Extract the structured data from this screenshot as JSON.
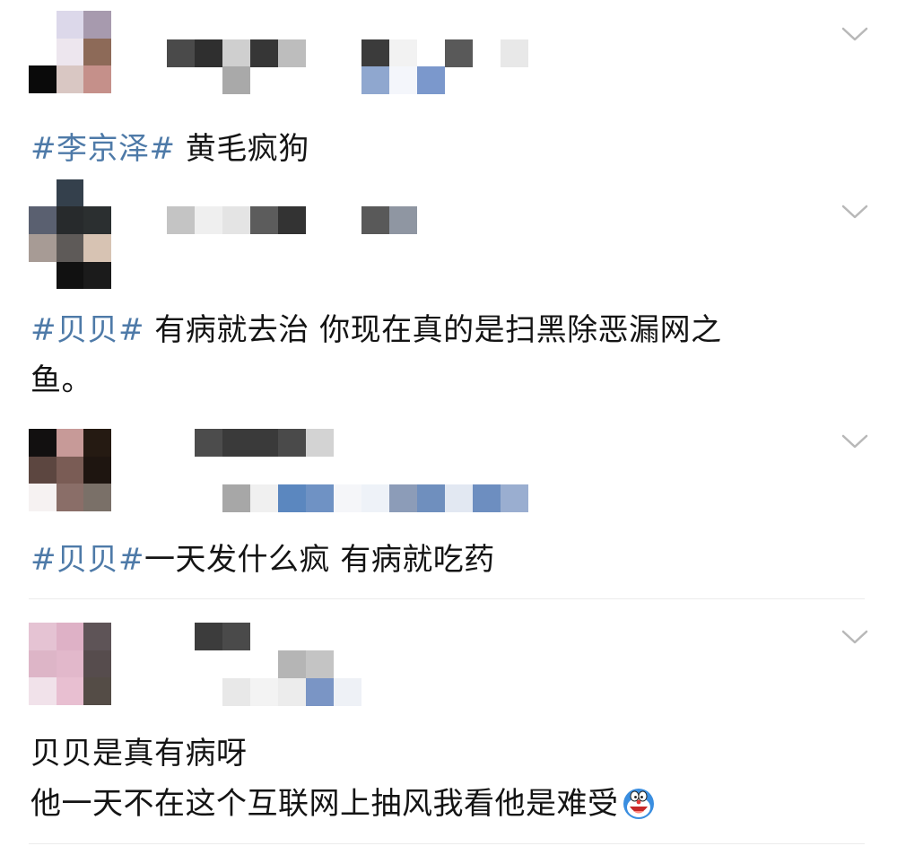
{
  "comments": [
    {
      "tag": "#李京泽#",
      "text": " 黄毛疯狗"
    },
    {
      "tag": "#贝贝#",
      "text": " 有病就去治 你现在真的是扫黑除恶漏网之",
      "text_line2": "鱼。"
    },
    {
      "tag": "#贝贝#",
      "text": "一天发什么疯 有病就吃药"
    },
    {
      "tag": "",
      "text": "贝贝是真有病呀",
      "text_line2": "他一天不在这个互联网上抽风我看他是难受"
    }
  ],
  "icons": {
    "chevron": "chevron-down-icon",
    "emoji": "doraemon-emoji-icon"
  },
  "colors": {
    "hashtag": "#4e7aa8",
    "text": "#141414",
    "chevron": "#b8b8b8",
    "divider": "#ececec"
  }
}
